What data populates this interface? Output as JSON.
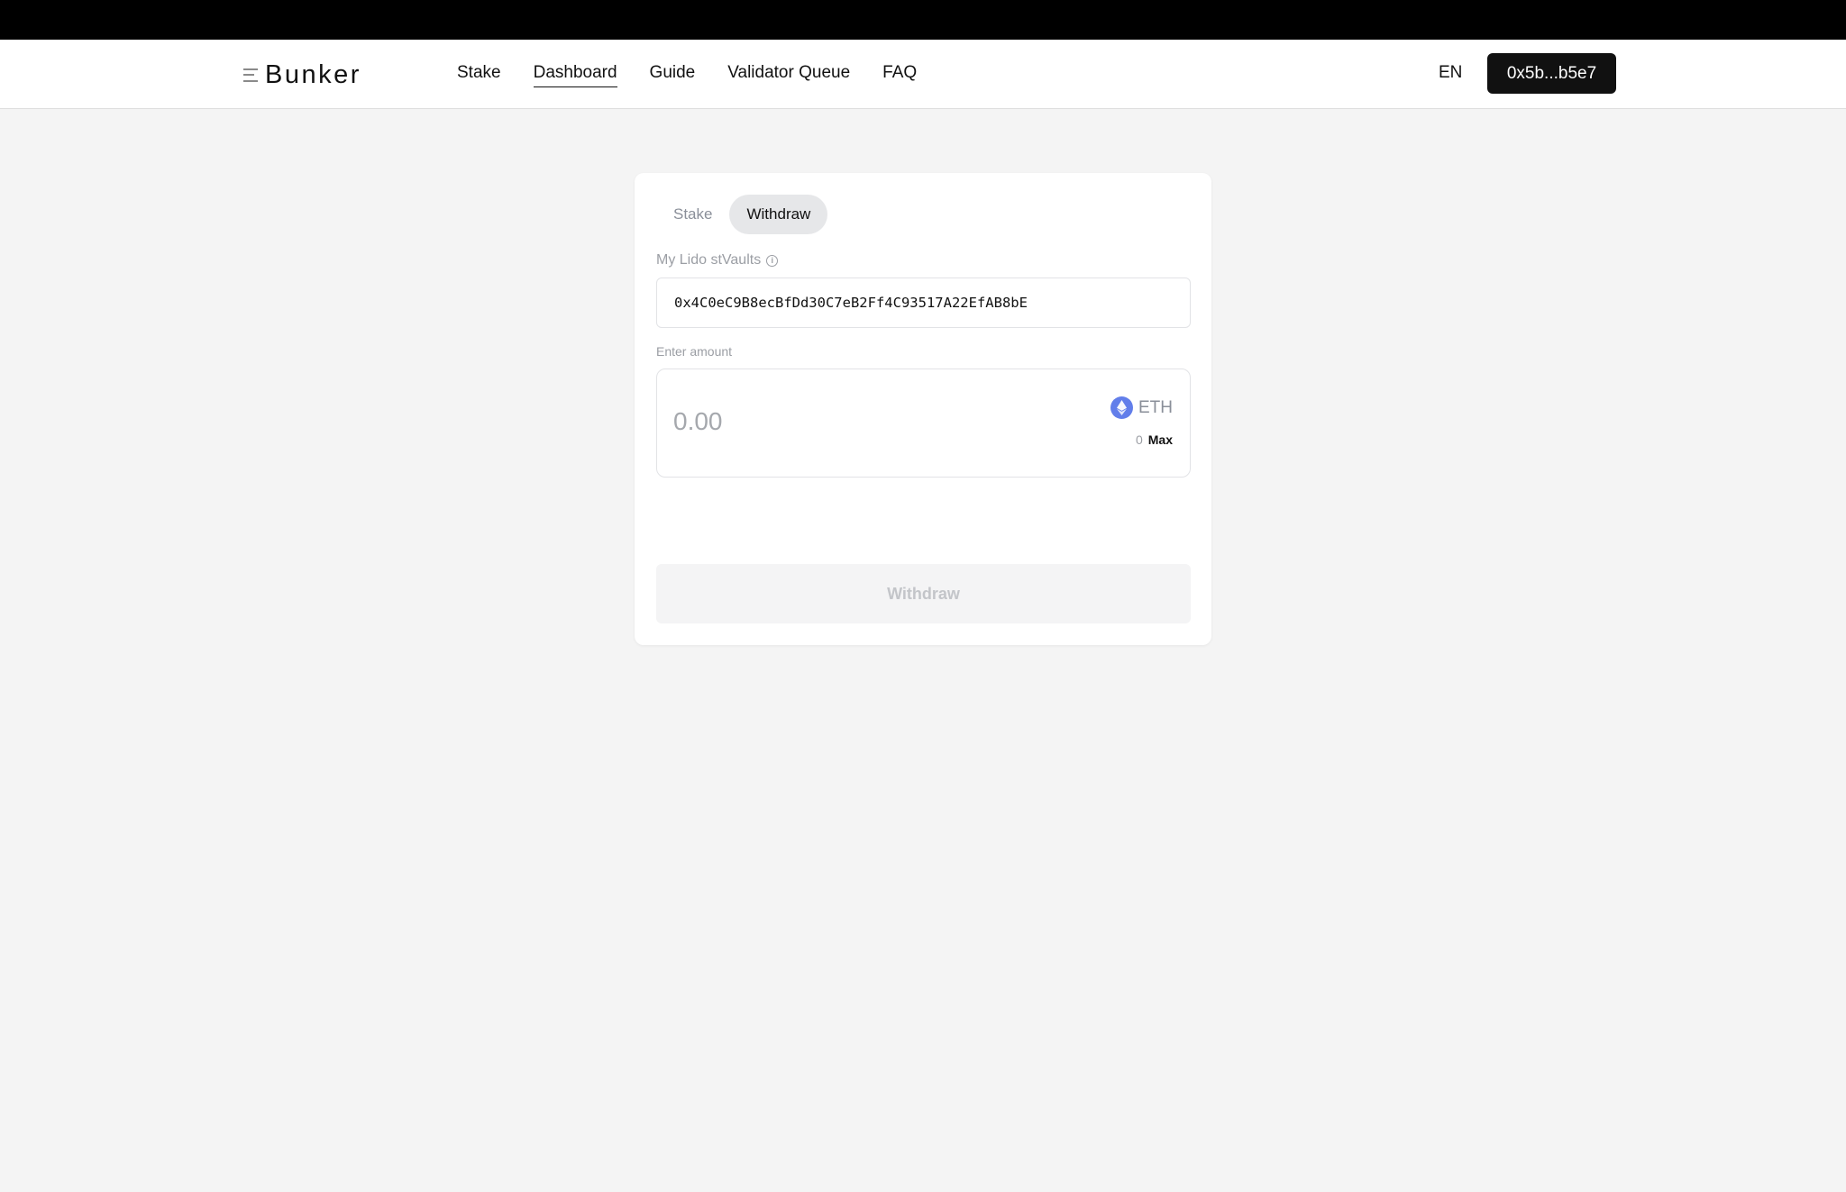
{
  "header": {
    "logo_text": "Bunker",
    "nav": [
      {
        "label": "Stake",
        "active": false
      },
      {
        "label": "Dashboard",
        "active": true
      },
      {
        "label": "Guide",
        "active": false
      },
      {
        "label": "Validator Queue",
        "active": false
      },
      {
        "label": "FAQ",
        "active": false
      }
    ],
    "language": "EN",
    "wallet_address": "0x5b...b5e7"
  },
  "card": {
    "tabs": [
      {
        "label": "Stake",
        "active": false
      },
      {
        "label": "Withdraw",
        "active": true
      }
    ],
    "vault_label": "My Lido stVaults",
    "vault_value": "0x4C0eC9B8ecBfDd30C7eB2Ff4C93517A22EfAB8bE",
    "amount_label": "Enter amount",
    "amount_placeholder": "0.00",
    "amount_value": "",
    "token": "ETH",
    "balance": "0",
    "max_label": "Max",
    "submit_label": "Withdraw",
    "submit_disabled": true
  },
  "colors": {
    "topbar": "#000000",
    "primary_button": "#111111",
    "eth_icon": "#627eea",
    "background": "#f4f4f4"
  }
}
